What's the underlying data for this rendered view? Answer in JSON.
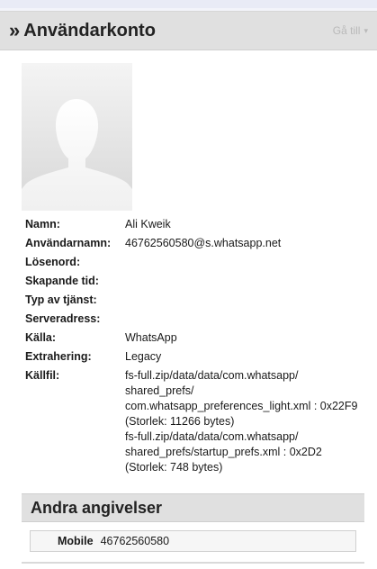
{
  "header": {
    "chevron": "»",
    "title": "Användarkonto",
    "goto_label": "Gå till",
    "goto_caret": "▾"
  },
  "avatar": {
    "icon": "user-silhouette-icon"
  },
  "properties": [
    {
      "key": "Namn:",
      "value": [
        "Ali Kweik"
      ]
    },
    {
      "key": "Användarnamn:",
      "value": [
        "46762560580@s.whatsapp.net"
      ]
    },
    {
      "key": "Lösenord:",
      "value": []
    },
    {
      "key": "Skapande tid:",
      "value": []
    },
    {
      "key": "Typ av tjänst:",
      "value": []
    },
    {
      "key": "Serveradress:",
      "value": []
    },
    {
      "key": "Källa:",
      "value": [
        "WhatsApp"
      ]
    },
    {
      "key": "Extrahering:",
      "value": [
        "Legacy"
      ]
    },
    {
      "key": "Källfil:",
      "value": [
        "fs-full.zip/data/data/com.whatsapp/",
        "shared_prefs/",
        "com.whatsapp_preferences_light.xml : 0x22F9",
        "(Storlek: 11266 bytes)",
        "fs-full.zip/data/data/com.whatsapp/",
        "shared_prefs/startup_prefs.xml : 0x2D2",
        "(Storlek: 748 bytes)"
      ]
    }
  ],
  "other_section": {
    "title": "Andra angivelser",
    "entries": [
      {
        "key": "Mobile",
        "value": "46762560580"
      }
    ]
  },
  "colors": {
    "header_bg": "#e0e0e0",
    "panel_bg": "#ffffff",
    "page_bg": "#f3f4fa"
  }
}
